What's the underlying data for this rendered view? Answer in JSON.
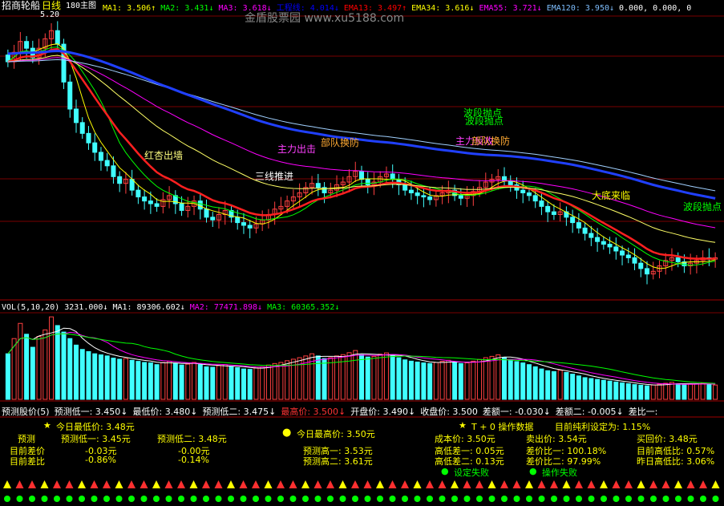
{
  "header": {
    "stock_name": "招商轮船",
    "period": "日线",
    "view_label": "180主图",
    "price_high_label": "5.20",
    "watermark": "金盾股票园  www.xu5188.com",
    "indicators": [
      {
        "label": "MA1:",
        "value": "3.506",
        "arrow": "↑",
        "color": "#ffff00"
      },
      {
        "label": "MA2:",
        "value": "3.431",
        "arrow": "↓",
        "color": "#00ff00"
      },
      {
        "label": "MA3:",
        "value": "3.618",
        "arrow": "↓",
        "color": "#ff00ff"
      },
      {
        "label": "工程线:",
        "value": "4.014",
        "arrow": "↓",
        "color": "#0000ff"
      },
      {
        "label": "EMA13:",
        "value": "3.497",
        "arrow": "↑",
        "color": "#ff0000"
      },
      {
        "label": "EMA34:",
        "value": "3.616",
        "arrow": "↓",
        "color": "#ffff00"
      },
      {
        "label": "EMA55:",
        "value": "3.721",
        "arrow": "↓",
        "color": "#ff00ff"
      },
      {
        "label": "EMA120:",
        "value": "3.950",
        "arrow": "↓",
        "color": "#7fbfff"
      },
      {
        "label": "",
        "value": "0.000,",
        "arrow": "",
        "color": "#ffffff"
      },
      {
        "label": "",
        "value": "0.000,",
        "arrow": "",
        "color": "#ffffff"
      },
      {
        "label": "",
        "value": "0",
        "arrow": "",
        "color": "#ffffff"
      }
    ]
  },
  "annotations": [
    {
      "text": "红杏出墙",
      "color": "#ffff80"
    },
    {
      "text": "三线推进",
      "color": "#ffffff"
    },
    {
      "text": "主力出击",
      "color": "#ff40ff"
    },
    {
      "text": "部队换防",
      "color": "#ffaa33"
    },
    {
      "text": "主力反攻",
      "color": "#ff40ff"
    },
    {
      "text": "部队换防",
      "color": "#ffaa33"
    },
    {
      "text": "波段抛点",
      "color": "#00ff00"
    },
    {
      "text": "波段抛点",
      "color": "#00ff00"
    },
    {
      "text": "大底来临",
      "color": "#ffff00"
    },
    {
      "text": "波段抛点",
      "color": "#00ff00"
    }
  ],
  "volume": {
    "title": "VOL(5,10,20)",
    "values": [
      {
        "label": "",
        "value": "3231.000",
        "arrow": "↓",
        "color": "#ffffff"
      },
      {
        "label": "MA1:",
        "value": "89306.602",
        "arrow": "↓",
        "color": "#ffffff"
      },
      {
        "label": "MA2:",
        "value": "77471.898",
        "arrow": "↓",
        "color": "#ff00ff"
      },
      {
        "label": "MA3:",
        "value": "60365.352",
        "arrow": "↓",
        "color": "#00ff00"
      }
    ]
  },
  "forecast_row": {
    "title": "预测股价(5)",
    "items": [
      {
        "label": "预测低一:",
        "value": "3.450",
        "arrow": "↓",
        "color": "#ffffff"
      },
      {
        "label": "最低价:",
        "value": "3.480",
        "arrow": "↓",
        "color": "#ffffff"
      },
      {
        "label": "预测低二:",
        "value": "3.475",
        "arrow": "↓",
        "color": "#ffffff"
      },
      {
        "label": "最高价:",
        "value": "3.500",
        "arrow": "↓",
        "color": "#ff3333"
      },
      {
        "label": "开盘价:",
        "value": "3.490",
        "arrow": "↓",
        "color": "#ffffff"
      },
      {
        "label": "收盘价:",
        "value": "3.500",
        "arrow": "",
        "color": "#ffffff"
      },
      {
        "label": "差额一:",
        "value": "-0.030",
        "arrow": "↓",
        "color": "#ffffff"
      },
      {
        "label": "差额二:",
        "value": "-0.005",
        "arrow": "↓",
        "color": "#ffffff"
      },
      {
        "label": "差比一:",
        "value": "",
        "arrow": "",
        "color": "#ffffff"
      }
    ]
  },
  "panel": {
    "today_low": "今日最低价: 3.48元",
    "today_high": "今日最高价: 3.50元",
    "forecast_label": "预测",
    "low1": "预测低一: 3.45元",
    "low2": "预测低二: 3.48元",
    "diff_label": "目前差价",
    "diff1": "-0.03元",
    "diff2": "-0.00元",
    "ratio_label": "目前差比",
    "ratio1": "-0.86%",
    "ratio2": "-0.14%",
    "high1": "预测高一: 3.53元",
    "high2": "预测高二: 3.61元",
    "t0_title": "T + 0 操作数据",
    "profit_setting": "目前纯利设定为: 1.15%",
    "cost": "成本价: 3.50元",
    "sell": "卖出价: 3.54元",
    "buyback": "买回价: 3.48元",
    "hl_diff1": "高低差一: 0.05元",
    "hl_diff2": "高低差二: 0.13元",
    "ratio_diff1": "差价比一: 100.18%",
    "ratio_diff2": "差价比二: 97.99%",
    "cur_hl_ratio": "目前高低比: 0.57%",
    "prev_hl_ratio": "昨日高低比: 3.06%",
    "set_fail": "设定失败",
    "op_fail": "操作失败"
  },
  "chart_data": {
    "type": "candlestick",
    "title": "招商轮船 日线",
    "price_range": [
      3.2,
      5.3
    ],
    "close": [
      4.95,
      5.02,
      5.1,
      5.05,
      4.98,
      5.05,
      5.12,
      5.18,
      5.08,
      4.8,
      4.6,
      4.5,
      4.42,
      4.35,
      4.28,
      4.22,
      4.18,
      4.1,
      4.05,
      4.08,
      4.0,
      3.95,
      3.92,
      3.9,
      3.88,
      3.93,
      3.96,
      3.9,
      3.85,
      3.88,
      3.92,
      3.86,
      3.8,
      3.78,
      3.82,
      3.85,
      3.8,
      3.76,
      3.74,
      3.72,
      3.75,
      3.78,
      3.82,
      3.86,
      3.88,
      3.92,
      3.95,
      3.98,
      4.02,
      4.05,
      4.02,
      3.98,
      4.0,
      4.04,
      4.06,
      4.1,
      4.14,
      4.08,
      4.04,
      4.06,
      4.1,
      4.12,
      4.08,
      4.04,
      4.0,
      3.98,
      3.96,
      3.95,
      3.93,
      3.96,
      3.98,
      4.0,
      3.96,
      3.94,
      3.96,
      3.99,
      4.02,
      4.06,
      4.08,
      4.1,
      4.07,
      4.04,
      4.0,
      3.98,
      3.96,
      3.92,
      3.88,
      3.84,
      3.82,
      3.84,
      3.8,
      3.76,
      3.72,
      3.68,
      3.65,
      3.62,
      3.6,
      3.58,
      3.55,
      3.52,
      3.5,
      3.46,
      3.42,
      3.38,
      3.4,
      3.44,
      3.48,
      3.5,
      3.47,
      3.44,
      3.46,
      3.48,
      3.5,
      3.49,
      3.5
    ],
    "volume": [
      210,
      280,
      350,
      300,
      240,
      290,
      320,
      380,
      340,
      310,
      280,
      250,
      230,
      220,
      210,
      205,
      200,
      190,
      185,
      188,
      180,
      175,
      170,
      168,
      160,
      170,
      175,
      165,
      158,
      162,
      170,
      160,
      150,
      148,
      155,
      160,
      152,
      146,
      140,
      138,
      145,
      150,
      158,
      165,
      170,
      178,
      185,
      192,
      200,
      210,
      200,
      188,
      192,
      200,
      206,
      215,
      225,
      205,
      195,
      198,
      208,
      214,
      202,
      192,
      182,
      176,
      172,
      168,
      165,
      170,
      175,
      180,
      170,
      165,
      168,
      176,
      184,
      192,
      198,
      205,
      194,
      184,
      174,
      168,
      160,
      150,
      140,
      132,
      128,
      134,
      124,
      116,
      108,
      100,
      96,
      92,
      88,
      84,
      80,
      76,
      72,
      68,
      65,
      62,
      66,
      70,
      74,
      78,
      72,
      68,
      70,
      72,
      74,
      70,
      66
    ]
  }
}
